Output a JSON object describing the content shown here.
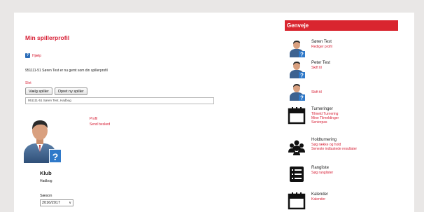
{
  "main": {
    "page_title": "Min spillerprofil",
    "help_label": "Hjælp",
    "saved_text": "951111-51 Søren Test er nu gemt som din spillerprofil",
    "delete_label": "Slet",
    "choose_player_label": "Vælg spiller",
    "create_player_label": "Opret ny spiller",
    "player_value": "951111-51 Søren Test, Hadbog",
    "profile_link": "Profil",
    "send_message_link": "Send besked",
    "klub_heading": "Klub",
    "klub_value": "Hadbog",
    "season_label": "Sæson",
    "season_value": "2016/2017"
  },
  "sidebar": {
    "header": "Genveje",
    "items": [
      {
        "title": "Søren Test",
        "links": [
          "Rediger profil"
        ],
        "icon": "person-icon"
      },
      {
        "title": "Peter Test",
        "links": [
          "Skift til"
        ],
        "icon": "person-icon"
      },
      {
        "title": "",
        "links": [
          "Skift til"
        ],
        "icon": "person-icon"
      },
      {
        "title": "Turneringer",
        "links": [
          "Tilmeld Turnering",
          "Mine Tilmeldinger",
          "Seniorpas"
        ],
        "icon": "calendar-icon"
      },
      {
        "title": "Holdturnering",
        "links": [
          "Søg række og hold",
          "Seneste indtastede resultater"
        ],
        "icon": "group-icon"
      },
      {
        "title": "Rangliste",
        "links": [
          "Søg ranglister"
        ],
        "icon": "list-icon"
      },
      {
        "title": "Kalender",
        "links": [
          "Kalender"
        ],
        "icon": "calendar-icon"
      }
    ]
  },
  "colors": {
    "accent": "#d71f35",
    "header": "#d9252f",
    "avatar_badge": "#2f79c9"
  }
}
